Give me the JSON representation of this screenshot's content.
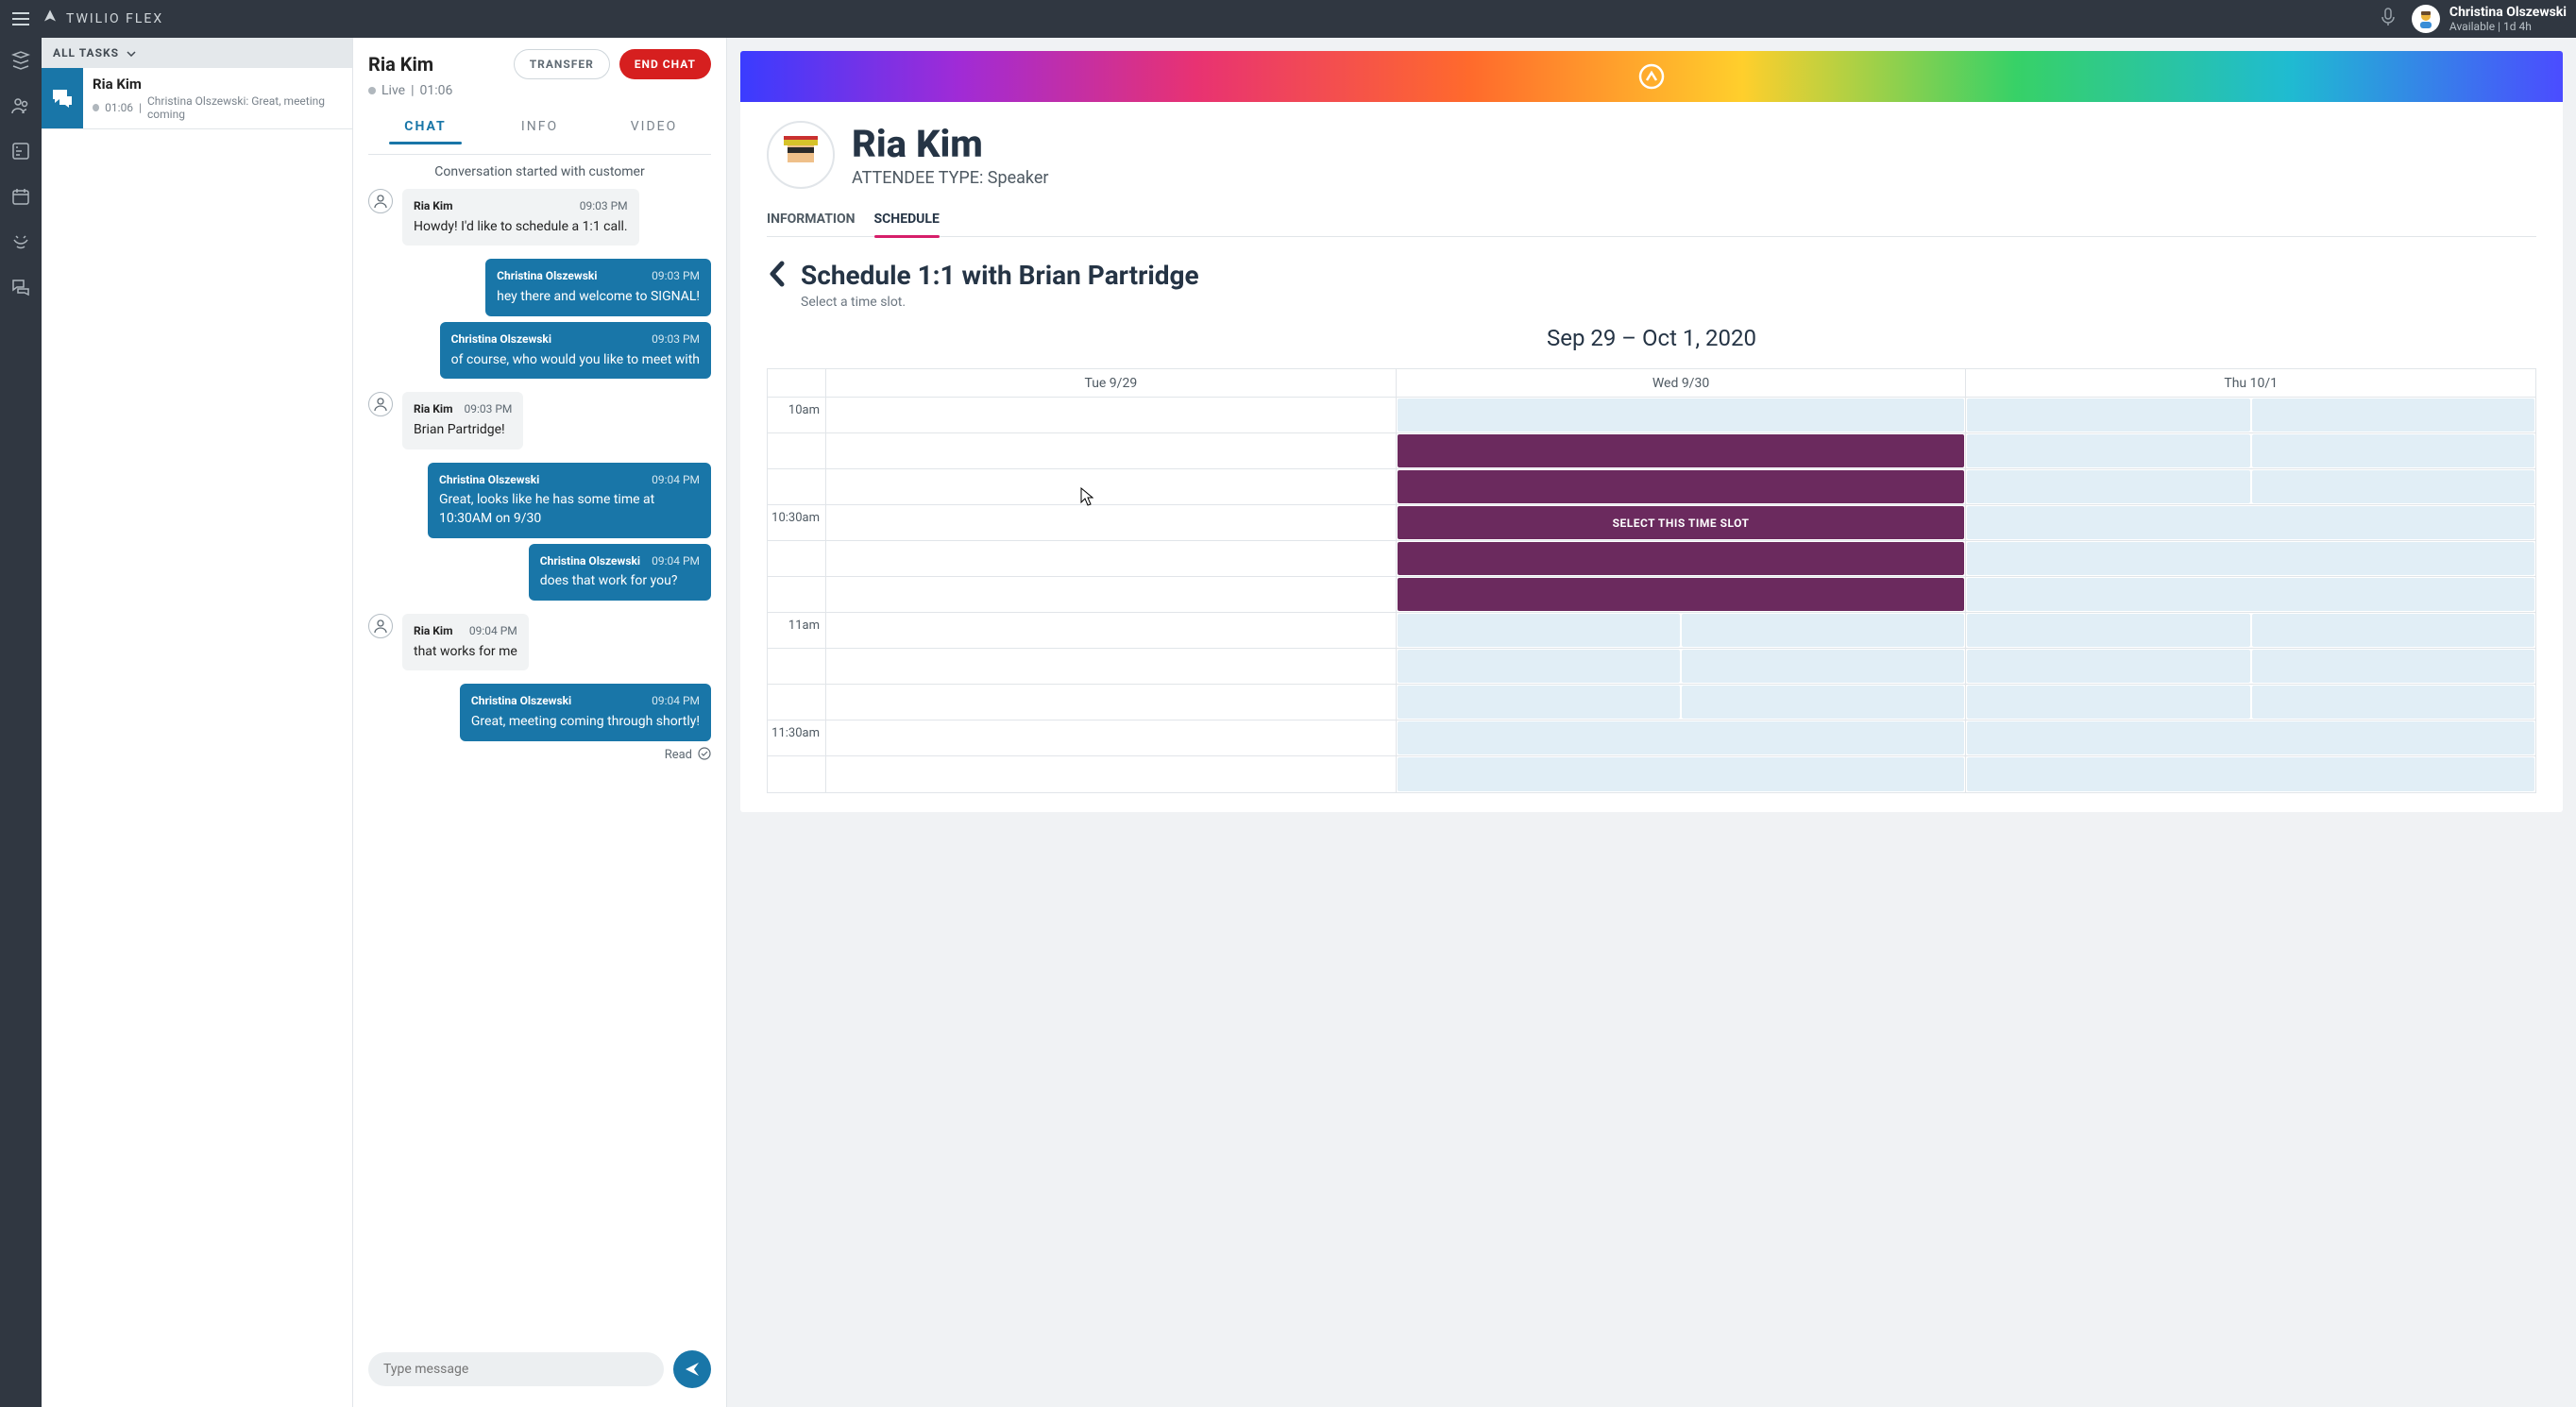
{
  "header": {
    "brand": "TWILIO FLEX",
    "user": {
      "name": "Christina Olszewski",
      "status": "Available | 1d 4h"
    }
  },
  "tasks": {
    "headerLabel": "ALL TASKS",
    "items": [
      {
        "title": "Ria Kim",
        "time": "01:06",
        "preview": "Christina Olszewski: Great, meeting coming"
      }
    ]
  },
  "chat": {
    "title": "Ria Kim",
    "statusPrefix": "Live",
    "duration": "01:06",
    "transferLabel": "TRANSFER",
    "endLabel": "END CHAT",
    "tabs": {
      "chat": "CHAT",
      "info": "INFO",
      "video": "VIDEO"
    },
    "conversationStarted": "Conversation started with customer",
    "messages": [
      {
        "dir": "in",
        "author": "Ria Kim",
        "time": "09:03 PM",
        "text": "Howdy! I'd like to schedule a 1:1 call."
      },
      {
        "dir": "out",
        "author": "Christina Olszewski",
        "time": "09:03 PM",
        "text": "hey there and welcome to SIGNAL!"
      },
      {
        "dir": "out",
        "author": "Christina Olszewski",
        "time": "09:03 PM",
        "text": "of course, who would you like to meet with"
      },
      {
        "dir": "in",
        "author": "Ria Kim",
        "time": "09:03 PM",
        "text": "Brian Partridge!"
      },
      {
        "dir": "out",
        "author": "Christina Olszewski",
        "time": "09:04 PM",
        "text": "Great, looks like he has some time at 10:30AM on 9/30"
      },
      {
        "dir": "out",
        "author": "Christina Olszewski",
        "time": "09:04 PM",
        "text": "does that work for you?"
      },
      {
        "dir": "in",
        "author": "Ria Kim",
        "time": "09:04 PM",
        "text": "that works for me"
      },
      {
        "dir": "out",
        "author": "Christina Olszewski",
        "time": "09:04 PM",
        "text": "Great, meeting coming through shortly!"
      }
    ],
    "readLabel": "Read",
    "composerPlaceholder": "Type message"
  },
  "context": {
    "name": "Ria Kim",
    "attendeeType": "ATTENDEE TYPE: Speaker",
    "tabs": {
      "info": "INFORMATION",
      "schedule": "SCHEDULE"
    },
    "schedule": {
      "title": "Schedule 1:1 with Brian Partridge",
      "subtitle": "Select a time slot.",
      "dateRange": "Sep 29 – Oct 1, 2020",
      "days": [
        "Tue 9/29",
        "Wed 9/30",
        "Thu 10/1"
      ],
      "times": [
        "10am",
        "",
        "",
        "10:30am",
        "",
        "",
        "11am",
        "",
        "",
        "11:30am",
        ""
      ],
      "selectLabel": "SELECT THIS TIME SLOT"
    }
  }
}
